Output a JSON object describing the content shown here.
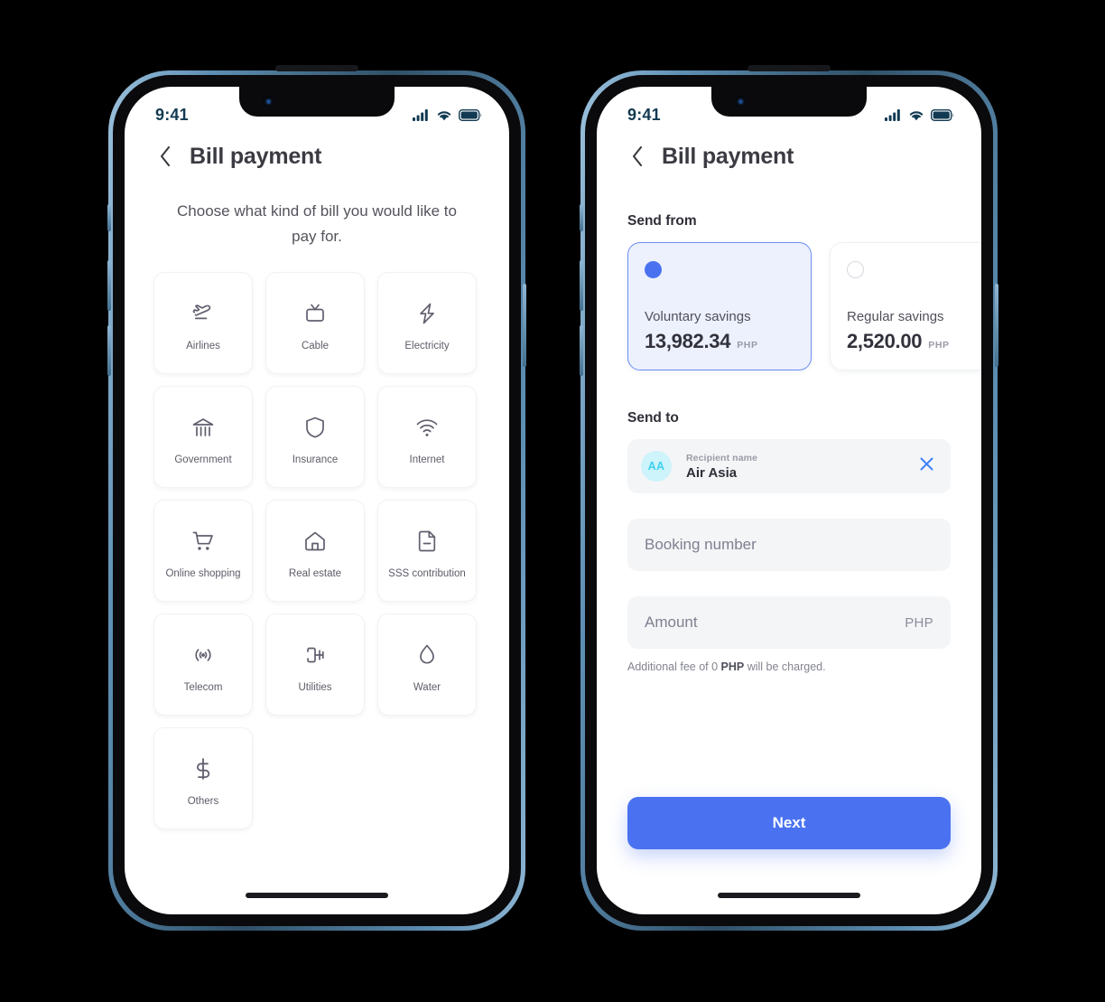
{
  "status_bar": {
    "time": "9:41",
    "icons": [
      "signal-icon",
      "wifi-icon",
      "battery-icon"
    ]
  },
  "colors": {
    "accent": "#4a72f0",
    "selected_card_bg": "#edf1fe",
    "selected_card_border": "#6a8ef4",
    "avatar_bg": "#cdf3fb",
    "avatar_text": "#3ed0ed",
    "field_bg": "#f4f5f7",
    "frame_blue": "#5d8fb4",
    "page_bg": "#000000"
  },
  "screen1": {
    "title": "Bill payment",
    "back_icon": "chevron-left-icon",
    "subtitle": "Choose what kind of bill you would like to pay for.",
    "categories": [
      {
        "label": "Airlines",
        "icon": "airplane-takeoff-icon"
      },
      {
        "label": "Cable",
        "icon": "television-icon"
      },
      {
        "label": "Electricity",
        "icon": "lightning-bolt-icon"
      },
      {
        "label": "Government",
        "icon": "bank-building-icon"
      },
      {
        "label": "Insurance",
        "icon": "shield-icon"
      },
      {
        "label": "Internet",
        "icon": "wifi-signal-icon"
      },
      {
        "label": "Online shopping",
        "icon": "shopping-cart-icon"
      },
      {
        "label": "Real estate",
        "icon": "house-icon"
      },
      {
        "label": "SSS contribution",
        "icon": "document-icon"
      },
      {
        "label": "Telecom",
        "icon": "broadcast-signal-icon"
      },
      {
        "label": "Utilities",
        "icon": "power-plug-icon"
      },
      {
        "label": "Water",
        "icon": "water-drop-icon"
      },
      {
        "label": "Others",
        "icon": "dollar-sign-icon"
      }
    ]
  },
  "screen2": {
    "title": "Bill payment",
    "back_icon": "chevron-left-icon",
    "send_from_label": "Send from",
    "accounts": [
      {
        "name": "Voluntary savings",
        "amount": "13,982.34",
        "currency": "PHP",
        "selected": true
      },
      {
        "name": "Regular savings",
        "amount": "2,520.00",
        "currency": "PHP",
        "selected": false
      }
    ],
    "send_to_label": "Send to",
    "recipient": {
      "avatar_initials": "AA",
      "label": "Recipient name",
      "name": "Air Asia",
      "clear_icon": "close-x-icon"
    },
    "booking_field": {
      "placeholder": "Booking number",
      "value": ""
    },
    "amount_field": {
      "placeholder": "Amount",
      "value": "",
      "suffix": "PHP"
    },
    "fee_note": {
      "prefix": "Additional fee of 0 ",
      "currency": "PHP",
      "suffix": " will be charged."
    },
    "next_label": "Next"
  }
}
